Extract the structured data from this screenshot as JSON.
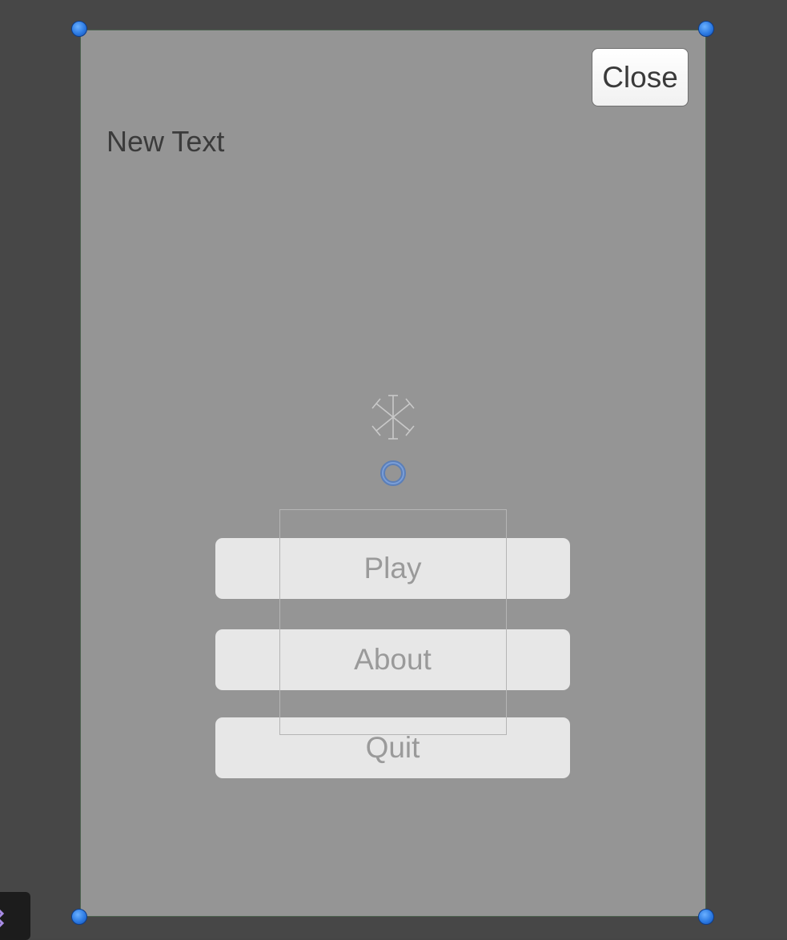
{
  "scene": {
    "close_label": "Close",
    "title_text": "New Text",
    "menu": {
      "play_label": "Play",
      "about_label": "About",
      "quit_label": "Quit"
    }
  },
  "icons": {
    "light": "directional-light-icon",
    "pivot": "pivot-icon",
    "corner": "toolbar-gizmo-icon"
  },
  "colors": {
    "panel": "#959595",
    "handle": "#2d7be3",
    "background": "#474747",
    "button": "#e7e7e7"
  }
}
